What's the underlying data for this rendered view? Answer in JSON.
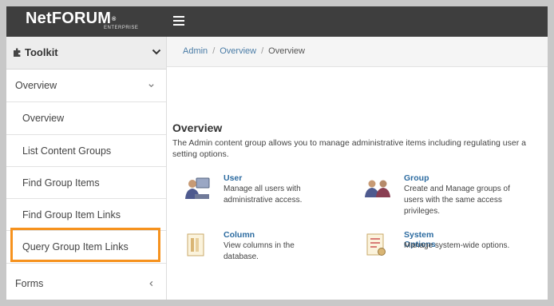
{
  "header": {
    "logo_text": "NetFORUM",
    "logo_reg": "®",
    "logo_sub": "ENTERPRISE",
    "bg_color": "#3e3e3e"
  },
  "sidebar": {
    "toolkit_label": "Toolkit",
    "items": [
      {
        "label": "Overview",
        "type": "group",
        "expanded": true
      },
      {
        "label": "Overview",
        "type": "sub"
      },
      {
        "label": "List Content Groups",
        "type": "sub"
      },
      {
        "label": "Find Group Items",
        "type": "sub"
      },
      {
        "label": "Find Group Item Links",
        "type": "sub",
        "highlighted": true
      },
      {
        "label": "Query Group Item Links",
        "type": "sub"
      },
      {
        "label": "Forms",
        "type": "group",
        "expanded": false
      }
    ],
    "highlight_color": "#f6921e"
  },
  "breadcrumb": {
    "items": [
      "Admin",
      "Overview",
      "Overview"
    ]
  },
  "main": {
    "title": "Overview",
    "description_line1": "The Admin content group allows you to manage administrative items including regulating user a",
    "description_line2": "setting options.",
    "cards": [
      {
        "title": "User",
        "line1": "Manage all users with",
        "line2": "administrative access.",
        "line3": "",
        "icon": "user-icon"
      },
      {
        "title": "Group",
        "line1": "Create and Manage groups of",
        "line2": "users with the same access",
        "line3": "privileges.",
        "icon": "group-icon"
      },
      {
        "title": "Column",
        "line1": "",
        "line2": "View columns in the",
        "line3": "database.",
        "icon": "column-icon"
      },
      {
        "title": "System Options",
        "line1": "Manage system-wide options.",
        "line2": "",
        "line3": "",
        "icon": "system-options-icon"
      }
    ]
  }
}
